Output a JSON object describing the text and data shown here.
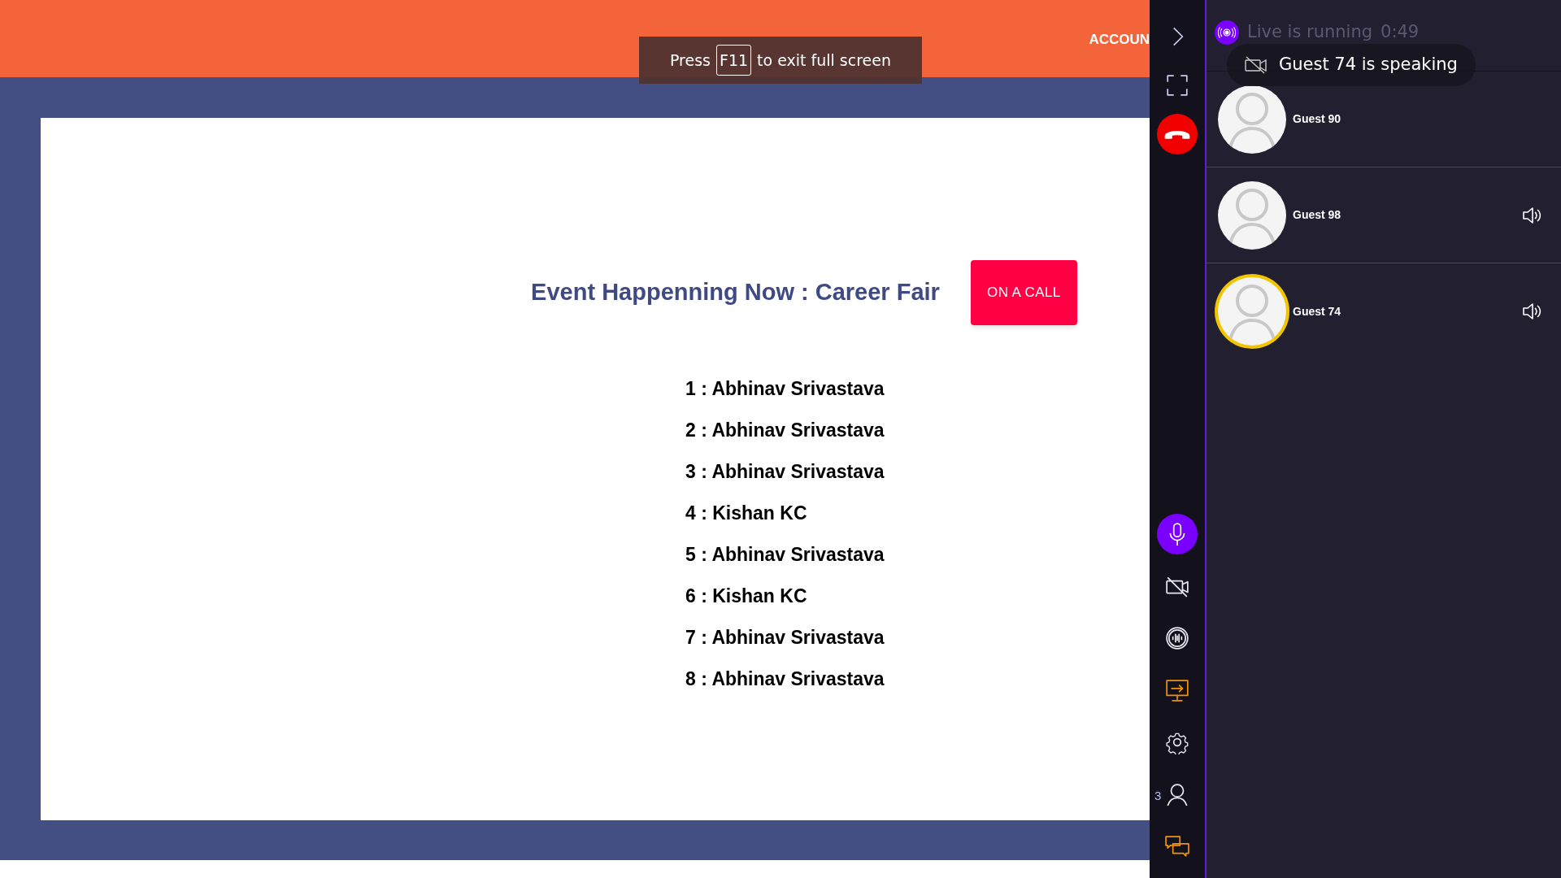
{
  "header": {
    "account_label": "ACCOUN"
  },
  "fullscreen_toast": {
    "before": "Press",
    "key": "F11",
    "after": "to exit full screen"
  },
  "event": {
    "title": "Event Happenning Now : Career Fair",
    "status_button": "ON A CALL",
    "attendees": [
      "1 : Abhinav Srivastava",
      "2 : Abhinav Srivastava",
      "3 : Abhinav Srivastava",
      "4 : Kishan KC",
      "5 : Abhinav Srivastava",
      "6 : Kishan KC",
      "7 : Abhinav Srivastava",
      "8 : Abhinav Srivastava"
    ]
  },
  "toolbar": {
    "top": [
      {
        "kind": "collapse",
        "active": false,
        "highlighted": false
      },
      {
        "kind": "fullscreen",
        "active": false,
        "highlighted": false
      },
      {
        "kind": "hangup",
        "active": true,
        "highlighted": false
      }
    ],
    "bottom": [
      {
        "kind": "mic",
        "active": true,
        "highlighted": false
      },
      {
        "kind": "video-off",
        "active": false,
        "highlighted": false
      },
      {
        "kind": "audio",
        "active": false,
        "highlighted": false
      },
      {
        "kind": "screen-share",
        "active": false,
        "highlighted": true
      },
      {
        "kind": "settings",
        "active": false,
        "highlighted": false
      },
      {
        "kind": "participants",
        "active": false,
        "highlighted": false,
        "count": "3"
      },
      {
        "kind": "chat",
        "active": false,
        "highlighted": true
      }
    ]
  },
  "live": {
    "text": "Live is running",
    "time": "0:49"
  },
  "notification": {
    "text": "Guest 74 is speaking"
  },
  "participants": [
    {
      "name": "Guest 90",
      "speaking": false,
      "audio": false
    },
    {
      "name": "Guest 98",
      "speaking": false,
      "audio": true
    },
    {
      "name": "Guest 74",
      "speaking": true,
      "audio": true
    }
  ]
}
